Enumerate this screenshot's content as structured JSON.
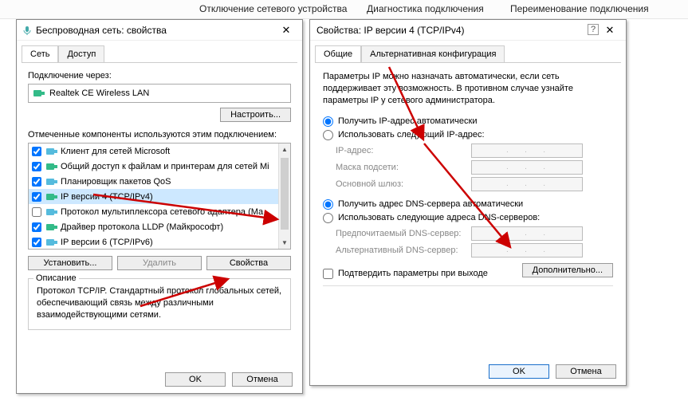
{
  "topbar": {
    "menu1": "Отключение сетевого устройства",
    "menu2": "Диагностика подключения",
    "menu3": "Переименование подключения"
  },
  "leftDialog": {
    "title": "Беспроводная сеть: свойства",
    "tabs": {
      "network": "Сеть",
      "sharing": "Доступ"
    },
    "connectVia": "Подключение через:",
    "adapter": "Realtek          CE Wireless LAN",
    "configureBtn": "Настроить...",
    "componentsUsed": "Отмеченные компоненты используются этим подключением:",
    "items": [
      {
        "checked": true,
        "label": "Клиент для сетей Microsoft"
      },
      {
        "checked": true,
        "label": "Общий доступ к файлам и принтерам для сетей Mi"
      },
      {
        "checked": true,
        "label": "Планировщик пакетов QoS"
      },
      {
        "checked": true,
        "label": "IP версии 4 (TCP/IPv4)"
      },
      {
        "checked": false,
        "label": "Протокол мультиплексора сетевого адаптера (Ма"
      },
      {
        "checked": true,
        "label": "Драйвер протокола LLDP (Майкрософт)"
      },
      {
        "checked": true,
        "label": "IP версии 6 (TCP/IPv6)"
      }
    ],
    "installBtn": "Установить...",
    "removeBtn": "Удалить",
    "propsBtn": "Свойства",
    "descLegend": "Описание",
    "descText": "Протокол TCP/IP. Стандартный протокол глобальных сетей, обеспечивающий связь между различными взаимодействующими сетями.",
    "ok": "OK",
    "cancel": "Отмена"
  },
  "rightDialog": {
    "title": "Свойства: IP версии 4 (TCP/IPv4)",
    "tabs": {
      "general": "Общие",
      "alt": "Альтернативная конфигурация"
    },
    "intro": "Параметры IP можно назначать автоматически, если сеть поддерживает эту возможность. В противном случае узнайте параметры IP у сетевого администратора.",
    "ipAutoRadio": "Получить IP-адрес автоматически",
    "ipManualRadio": "Использовать следующий IP-адрес:",
    "ipAddress": "IP-адрес:",
    "subnet": "Маска подсети:",
    "gateway": "Основной шлюз:",
    "dnsAutoRadio": "Получить адрес DNS-сервера автоматически",
    "dnsManualRadio": "Использовать следующие адреса DNS-серверов:",
    "dnsPreferred": "Предпочитаемый DNS-сервер:",
    "dnsAlt": "Альтернативный DNS-сервер:",
    "validate": "Подтвердить параметры при выходе",
    "advanced": "Дополнительно...",
    "ok": "OK",
    "cancel": "Отмена"
  }
}
